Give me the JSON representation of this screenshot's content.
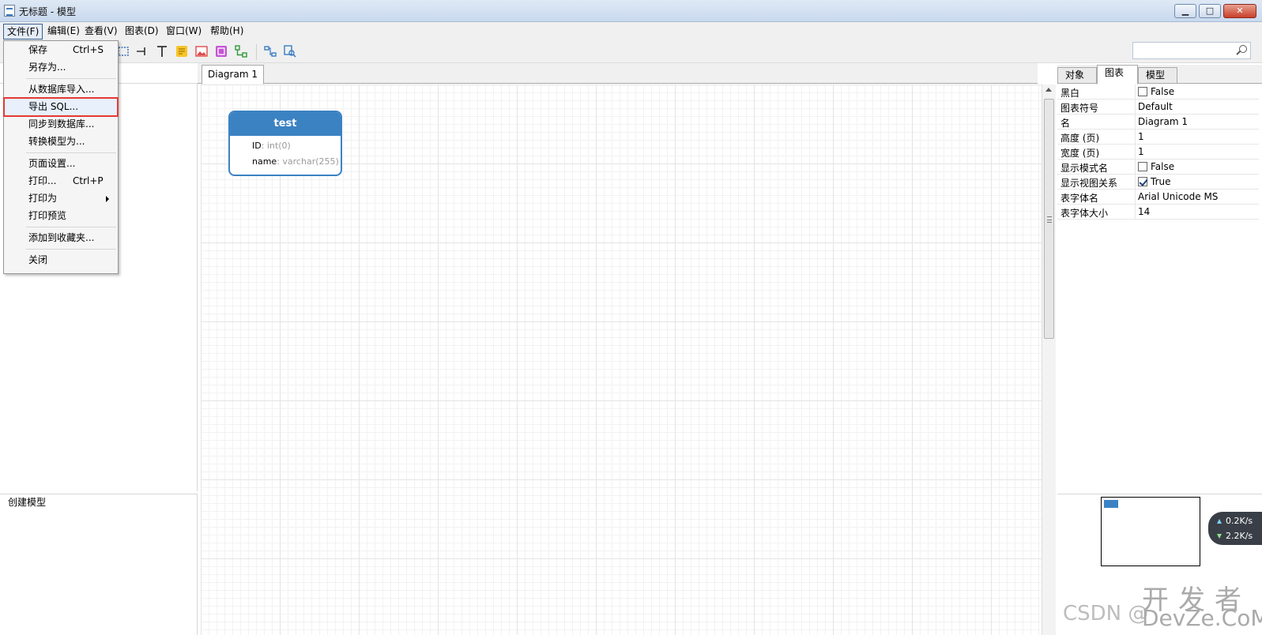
{
  "window": {
    "title": "无标题 - 模型",
    "min_label": "▁",
    "max_label": "□",
    "close_label": "✕"
  },
  "menubar": {
    "file": "文件(F)",
    "edit": "编辑(E)",
    "view": "查看(V)",
    "diagram": "图表(D)",
    "window": "窗口(W)",
    "help": "帮助(H)"
  },
  "file_menu": {
    "save": "保存",
    "save_shortcut": "Ctrl+S",
    "save_as": "另存为...",
    "import_db": "从数据库导入...",
    "export_sql": "导出 SQL...",
    "sync_db": "同步到数据库...",
    "convert_model": "转换模型为...",
    "page_setup": "页面设置...",
    "print": "打印...",
    "print_shortcut": "Ctrl+P",
    "print_as": "打印为",
    "print_preview": "打印预览",
    "add_favorite": "添加到收藏夹...",
    "close": "关闭"
  },
  "diagram_tab": "Diagram 1",
  "entity": {
    "name": "test",
    "fields": [
      {
        "name": "ID",
        "type": ": int(0)"
      },
      {
        "name": "name",
        "type": ": varchar(255)"
      }
    ]
  },
  "left_panel": {
    "status": "创建模型"
  },
  "right_tabs": {
    "object": "对象",
    "diagram": "图表",
    "model": "模型"
  },
  "properties": [
    {
      "key": "黑白",
      "value": "False",
      "checkbox": false
    },
    {
      "key": "图表符号",
      "value": "Default"
    },
    {
      "key": "名",
      "value": "Diagram 1"
    },
    {
      "key": "高度 (页)",
      "value": "1"
    },
    {
      "key": "宽度 (页)",
      "value": "1"
    },
    {
      "key": "显示模式名",
      "value": "False",
      "checkbox": false
    },
    {
      "key": "显示视图关系",
      "value": "True",
      "checkbox": true
    },
    {
      "key": "表字体名",
      "value": "Arial Unicode MS"
    },
    {
      "key": "表字体大小",
      "value": "14"
    }
  ],
  "network": {
    "up": "0.2K/s",
    "down": "2.2K/s"
  },
  "watermark": {
    "csdn": "CSDN @",
    "kfz": "开发者",
    "devze": "DevZe.CoM"
  },
  "colors": {
    "accent": "#3b82c3",
    "highlight_border": "#e53935"
  }
}
